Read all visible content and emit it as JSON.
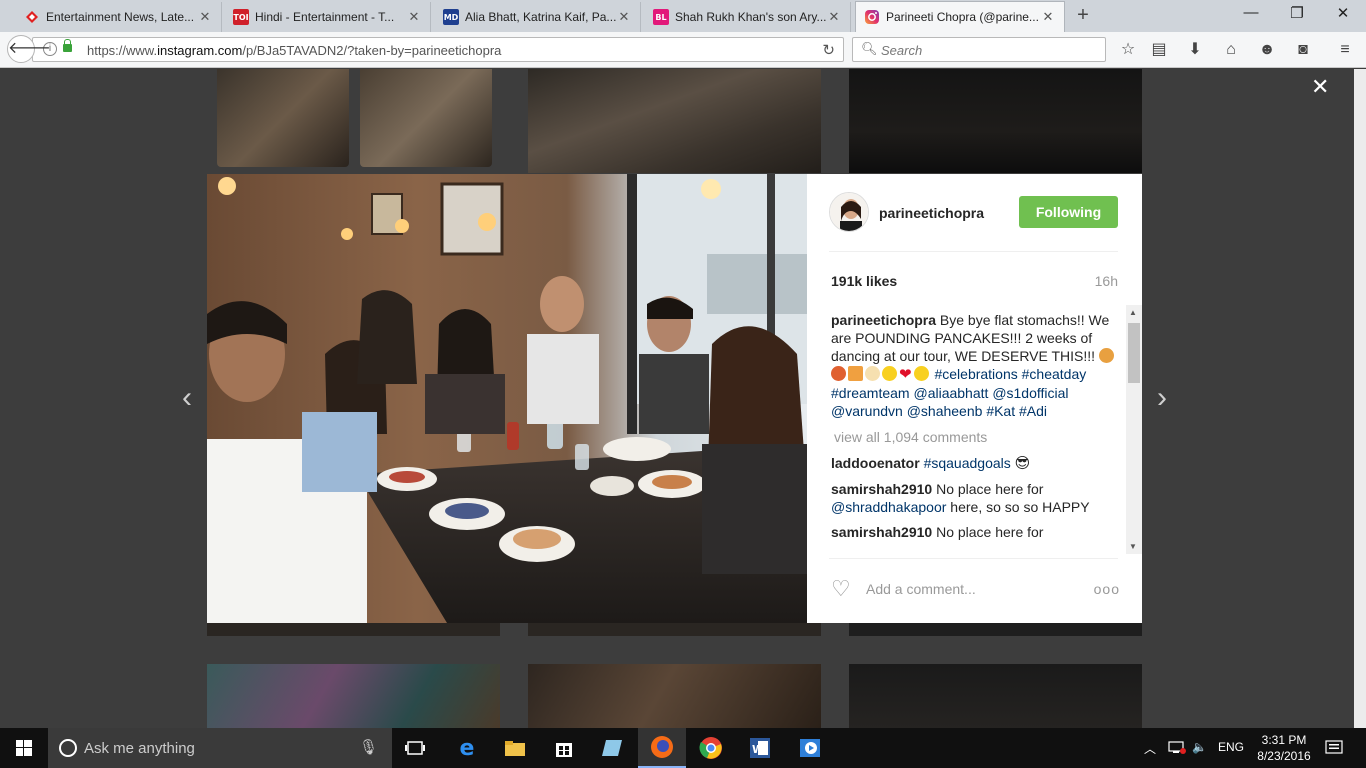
{
  "browser": {
    "tabs": [
      {
        "title": "Entertainment News, Late...",
        "favicon": "red-diamond-icon",
        "color": "#e02020"
      },
      {
        "title": "Hindi - Entertainment - T...",
        "favicon": "toi-icon",
        "badge": "TOI",
        "color": "#d0202a"
      },
      {
        "title": "Alia Bhatt, Katrina Kaif, Pa...",
        "favicon": "md-icon",
        "badge": "MD",
        "color": "#1f3f8f"
      },
      {
        "title": "Shah Rukh Khan's son Ary...",
        "favicon": "bl-icon",
        "badge": "BL",
        "color": "#e2187a"
      },
      {
        "title": "Parineeti Chopra (@parine...",
        "favicon": "instagram-icon",
        "color": "#c13584",
        "active": true
      }
    ],
    "url_prefix": "https://www.",
    "url_domain": "instagram.com",
    "url_rest": "/p/BJa5TAVADN2/?taken-by=parineetichopra",
    "search_placeholder": "Search"
  },
  "post": {
    "username": "parineetichopra",
    "follow_label": "Following",
    "likes": "191k likes",
    "time": "16h",
    "caption_user": "parineetichopra",
    "caption_text": "Bye bye flat stomachs!! We are POUNDING PANCAKES!!! 2 weeks of dancing at our tour, WE DESERVE THIS!!!",
    "hashtags": [
      "#celebrations",
      "#cheatday",
      "#dreamteam"
    ],
    "mentions": [
      "@aliaabhatt",
      "@s1dofficial",
      "@varundvn",
      "@shaheenb"
    ],
    "extra_tags": [
      "#Kat",
      "#Adi"
    ],
    "view_all": "view all 1,094 comments",
    "comments": [
      {
        "user": "laddooenator",
        "text": "",
        "tag": "#sqauadgoals"
      },
      {
        "user": "samirshah2910",
        "text": "No place here for",
        "mention": "@shraddhakapoor",
        "text2": "here, so so so HAPPY"
      },
      {
        "user": "samirshah2910",
        "text": "No place here for"
      }
    ],
    "add_comment_placeholder": "Add a comment...",
    "more": "ooo"
  },
  "taskbar": {
    "search_text": "Ask me anything",
    "lang": "ENG",
    "time": "3:31 PM",
    "date": "8/23/2016"
  }
}
